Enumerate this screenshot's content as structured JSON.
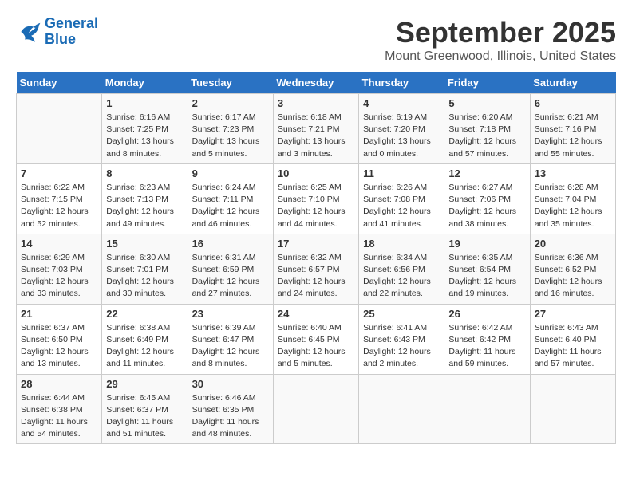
{
  "header": {
    "logo_line1": "General",
    "logo_line2": "Blue",
    "month": "September 2025",
    "location": "Mount Greenwood, Illinois, United States"
  },
  "weekdays": [
    "Sunday",
    "Monday",
    "Tuesday",
    "Wednesday",
    "Thursday",
    "Friday",
    "Saturday"
  ],
  "weeks": [
    [
      {
        "day": "",
        "info": ""
      },
      {
        "day": "1",
        "info": "Sunrise: 6:16 AM\nSunset: 7:25 PM\nDaylight: 13 hours\nand 8 minutes."
      },
      {
        "day": "2",
        "info": "Sunrise: 6:17 AM\nSunset: 7:23 PM\nDaylight: 13 hours\nand 5 minutes."
      },
      {
        "day": "3",
        "info": "Sunrise: 6:18 AM\nSunset: 7:21 PM\nDaylight: 13 hours\nand 3 minutes."
      },
      {
        "day": "4",
        "info": "Sunrise: 6:19 AM\nSunset: 7:20 PM\nDaylight: 13 hours\nand 0 minutes."
      },
      {
        "day": "5",
        "info": "Sunrise: 6:20 AM\nSunset: 7:18 PM\nDaylight: 12 hours\nand 57 minutes."
      },
      {
        "day": "6",
        "info": "Sunrise: 6:21 AM\nSunset: 7:16 PM\nDaylight: 12 hours\nand 55 minutes."
      }
    ],
    [
      {
        "day": "7",
        "info": "Sunrise: 6:22 AM\nSunset: 7:15 PM\nDaylight: 12 hours\nand 52 minutes."
      },
      {
        "day": "8",
        "info": "Sunrise: 6:23 AM\nSunset: 7:13 PM\nDaylight: 12 hours\nand 49 minutes."
      },
      {
        "day": "9",
        "info": "Sunrise: 6:24 AM\nSunset: 7:11 PM\nDaylight: 12 hours\nand 46 minutes."
      },
      {
        "day": "10",
        "info": "Sunrise: 6:25 AM\nSunset: 7:10 PM\nDaylight: 12 hours\nand 44 minutes."
      },
      {
        "day": "11",
        "info": "Sunrise: 6:26 AM\nSunset: 7:08 PM\nDaylight: 12 hours\nand 41 minutes."
      },
      {
        "day": "12",
        "info": "Sunrise: 6:27 AM\nSunset: 7:06 PM\nDaylight: 12 hours\nand 38 minutes."
      },
      {
        "day": "13",
        "info": "Sunrise: 6:28 AM\nSunset: 7:04 PM\nDaylight: 12 hours\nand 35 minutes."
      }
    ],
    [
      {
        "day": "14",
        "info": "Sunrise: 6:29 AM\nSunset: 7:03 PM\nDaylight: 12 hours\nand 33 minutes."
      },
      {
        "day": "15",
        "info": "Sunrise: 6:30 AM\nSunset: 7:01 PM\nDaylight: 12 hours\nand 30 minutes."
      },
      {
        "day": "16",
        "info": "Sunrise: 6:31 AM\nSunset: 6:59 PM\nDaylight: 12 hours\nand 27 minutes."
      },
      {
        "day": "17",
        "info": "Sunrise: 6:32 AM\nSunset: 6:57 PM\nDaylight: 12 hours\nand 24 minutes."
      },
      {
        "day": "18",
        "info": "Sunrise: 6:34 AM\nSunset: 6:56 PM\nDaylight: 12 hours\nand 22 minutes."
      },
      {
        "day": "19",
        "info": "Sunrise: 6:35 AM\nSunset: 6:54 PM\nDaylight: 12 hours\nand 19 minutes."
      },
      {
        "day": "20",
        "info": "Sunrise: 6:36 AM\nSunset: 6:52 PM\nDaylight: 12 hours\nand 16 minutes."
      }
    ],
    [
      {
        "day": "21",
        "info": "Sunrise: 6:37 AM\nSunset: 6:50 PM\nDaylight: 12 hours\nand 13 minutes."
      },
      {
        "day": "22",
        "info": "Sunrise: 6:38 AM\nSunset: 6:49 PM\nDaylight: 12 hours\nand 11 minutes."
      },
      {
        "day": "23",
        "info": "Sunrise: 6:39 AM\nSunset: 6:47 PM\nDaylight: 12 hours\nand 8 minutes."
      },
      {
        "day": "24",
        "info": "Sunrise: 6:40 AM\nSunset: 6:45 PM\nDaylight: 12 hours\nand 5 minutes."
      },
      {
        "day": "25",
        "info": "Sunrise: 6:41 AM\nSunset: 6:43 PM\nDaylight: 12 hours\nand 2 minutes."
      },
      {
        "day": "26",
        "info": "Sunrise: 6:42 AM\nSunset: 6:42 PM\nDaylight: 11 hours\nand 59 minutes."
      },
      {
        "day": "27",
        "info": "Sunrise: 6:43 AM\nSunset: 6:40 PM\nDaylight: 11 hours\nand 57 minutes."
      }
    ],
    [
      {
        "day": "28",
        "info": "Sunrise: 6:44 AM\nSunset: 6:38 PM\nDaylight: 11 hours\nand 54 minutes."
      },
      {
        "day": "29",
        "info": "Sunrise: 6:45 AM\nSunset: 6:37 PM\nDaylight: 11 hours\nand 51 minutes."
      },
      {
        "day": "30",
        "info": "Sunrise: 6:46 AM\nSunset: 6:35 PM\nDaylight: 11 hours\nand 48 minutes."
      },
      {
        "day": "",
        "info": ""
      },
      {
        "day": "",
        "info": ""
      },
      {
        "day": "",
        "info": ""
      },
      {
        "day": "",
        "info": ""
      }
    ]
  ]
}
